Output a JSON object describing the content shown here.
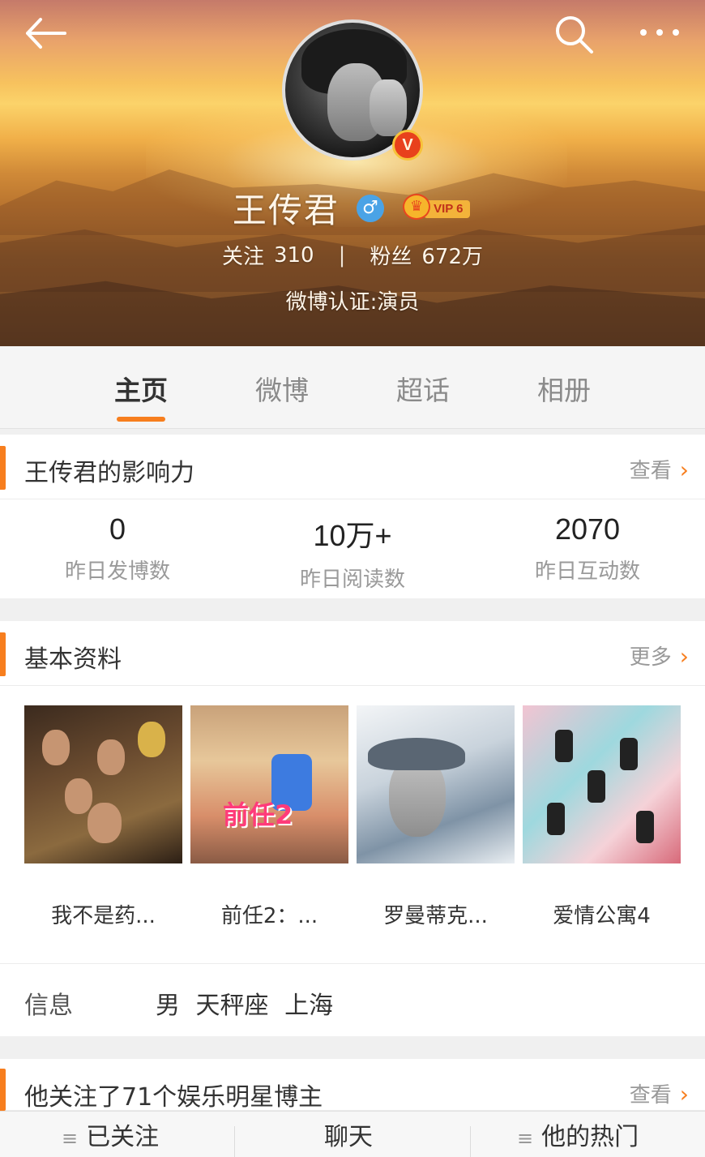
{
  "header": {
    "user_name": "王传君",
    "gender_symbol": "♂",
    "verified_symbol": "V",
    "vip_label": "VIP 6",
    "crown_symbol": "♛",
    "following_label": "关注",
    "following_count": "310",
    "separator": "|",
    "fans_label": "粉丝",
    "fans_count": "672万",
    "verification": "微博认证:演员"
  },
  "tabs": [
    {
      "label": "主页",
      "active": true
    },
    {
      "label": "微博",
      "active": false
    },
    {
      "label": "超话",
      "active": false
    },
    {
      "label": "相册",
      "active": false
    }
  ],
  "influence": {
    "title": "王传君的影响力",
    "link": "查看",
    "metrics": [
      {
        "value": "0",
        "label": "昨日发博数"
      },
      {
        "value": "10万+",
        "label": "昨日阅读数"
      },
      {
        "value": "2070",
        "label": "昨日互动数"
      }
    ]
  },
  "basic_info": {
    "title": "基本资料",
    "link": "更多",
    "works": [
      {
        "title": "我不是药..."
      },
      {
        "title": "前任2：..."
      },
      {
        "title": "罗曼蒂克..."
      },
      {
        "title": "爱情公寓4"
      }
    ],
    "poster2_text": "前任2",
    "info_label": "信息",
    "info_value": "男 天秤座 上海"
  },
  "following_stars": {
    "title": "他关注了71个娱乐明星博主",
    "link": "查看"
  },
  "bottom_bar": {
    "followed": "已关注",
    "chat": "聊天",
    "hot": "他的热门"
  },
  "icons": {
    "chevron": "›",
    "menu": "≡"
  },
  "colors": {
    "accent": "#f77e1e",
    "verified": "#e8411c",
    "gender": "#4aa3e6"
  }
}
